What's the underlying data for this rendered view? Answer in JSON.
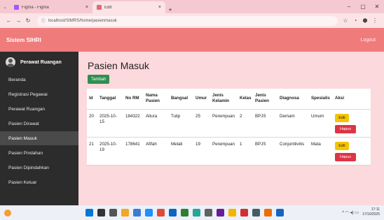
{
  "browser": {
    "tabs": [
      {
        "title": "Figma - Figma",
        "fav_color": "#a259ff",
        "active": false
      },
      {
        "title": "Edit",
        "fav_color": "#e06c75",
        "active": true
      }
    ],
    "new_tab_symbol": "+",
    "close_symbol": "×",
    "window_controls": {
      "minimize": "–",
      "maximize": "▢",
      "close": "✕"
    },
    "url": "localhost/SIMRS/home/pasienmasuk",
    "nav": {
      "back": "←",
      "forward": "→",
      "reload": "↻",
      "info": "ⓘ"
    },
    "toolbar": {
      "star": "☆",
      "profile": "◔",
      "extension": "⬢",
      "menu": "⋮"
    }
  },
  "header": {
    "brand": "Sistem SIHRI",
    "logout": "Logout"
  },
  "sidebar": {
    "user": "Perawat Ruangan",
    "items": [
      {
        "label": "Beranda",
        "active": false
      },
      {
        "label": "Registrasi Pegawai",
        "active": false
      },
      {
        "label": "Perawat Ruangan",
        "active": false
      },
      {
        "label": "Pasien Dirawat",
        "active": false
      },
      {
        "label": "Pasien Masuk",
        "active": true
      },
      {
        "label": "Pasien Pindahan",
        "active": false
      },
      {
        "label": "Pasien Dipindahkan",
        "active": false
      },
      {
        "label": "Pasien Keluar",
        "active": false
      }
    ]
  },
  "main": {
    "title": "Pasien Masuk",
    "add_button": "Tambah",
    "columns": [
      "Id",
      "Tanggal",
      "No RM",
      "Nama Pasien",
      "Bangsal",
      "Umur",
      "Jenis Kelamin",
      "Kelas",
      "Jenis Pasien",
      "Diagnosa",
      "Spesialis",
      "Aksi"
    ],
    "rows": [
      {
        "id": "20",
        "tanggal": "2025-10-15",
        "no_rm": "184322",
        "nama": "Altura",
        "bangsal": "Tulip",
        "umur": "25",
        "jk": "Perempuan",
        "kelas": "2",
        "jenis": "BPJS",
        "diagnosa": "Demam",
        "spesialis": "Umum",
        "edit": "Edit",
        "hapus": "Hapus"
      },
      {
        "id": "21",
        "tanggal": "2025-10-19",
        "no_rm": "178641",
        "nama": "Afifah",
        "bangsal": "Melati",
        "umur": "19",
        "jk": "Perempuan",
        "kelas": "1",
        "jenis": "BPJS",
        "diagnosa": "Conjunttivitis",
        "spesialis": "Mata",
        "edit": "Edit",
        "hapus": "Hapus"
      }
    ]
  },
  "taskbar": {
    "clock_time": "17:11",
    "clock_date": "17/10/2025",
    "tray_symbols": "^  ◠  ◂)  ▭",
    "icon_colors": [
      "#0078d4",
      "#333333",
      "#555555",
      "#f5a623",
      "#3a7bd5",
      "#1e90ff",
      "#dd4b39",
      "#0a66c2",
      "#2e7d32",
      "#26a69a",
      "#616161",
      "#6a1b9a",
      "#f4b400",
      "#d32f2f",
      "#455a64",
      "#ef6c00",
      "#1565c0"
    ]
  }
}
